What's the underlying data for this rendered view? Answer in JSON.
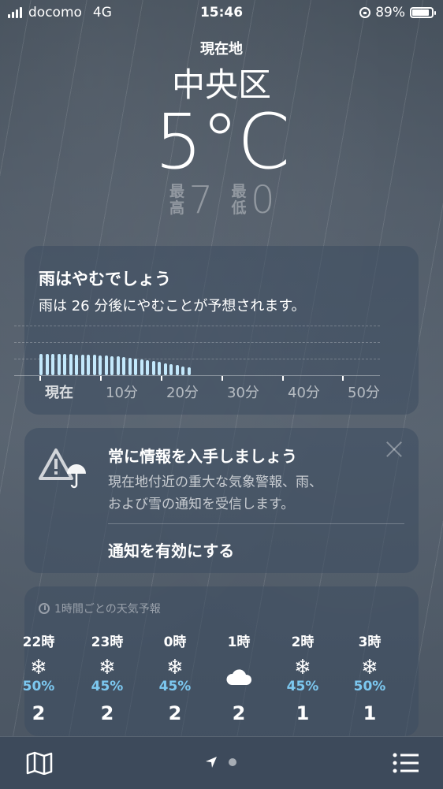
{
  "status": {
    "carrier": "docomo",
    "network": "4G",
    "time": "15:46",
    "battery": "89%",
    "battery_level": 0.89
  },
  "header": {
    "label": "現在地",
    "city": "中央区",
    "temp": "5°C",
    "high_label": "最高",
    "high": "7",
    "low_label": "最低",
    "low": "0"
  },
  "rain_card": {
    "title": "雨はやむでしょう",
    "desc": "雨は 26 分後にやむことが予想されます。",
    "ticks": [
      "現在",
      "10分",
      "20分",
      "30分",
      "40分",
      "50分"
    ],
    "intensity": [
      0.85,
      0.85,
      0.84,
      0.84,
      0.83,
      0.83,
      0.82,
      0.82,
      0.81,
      0.8,
      0.79,
      0.78,
      0.76,
      0.74,
      0.72,
      0.7,
      0.67,
      0.64,
      0.6,
      0.56,
      0.52,
      0.48,
      0.44,
      0.4,
      0.35,
      0.3
    ]
  },
  "notify_card": {
    "title": "常に情報を入手しましょう",
    "desc1": "現在地付近の重大な気象警報、雨、",
    "desc2": "および雪の通知を受信します。",
    "action": "通知を有効にする"
  },
  "hourly": {
    "title": "1時間ごとの天気予報",
    "items": [
      {
        "hour": "22時",
        "icon": "snow-icon",
        "pct": "50%",
        "val": "2"
      },
      {
        "hour": "23時",
        "icon": "snow-icon",
        "pct": "45%",
        "val": "2"
      },
      {
        "hour": "0時",
        "icon": "snow-icon",
        "pct": "45%",
        "val": "2"
      },
      {
        "hour": "1時",
        "icon": "cloud-icon",
        "pct": "",
        "val": "2"
      },
      {
        "hour": "2時",
        "icon": "snow-icon",
        "pct": "45%",
        "val": "1"
      },
      {
        "hour": "3時",
        "icon": "snow-icon",
        "pct": "50%",
        "val": "1"
      }
    ]
  }
}
